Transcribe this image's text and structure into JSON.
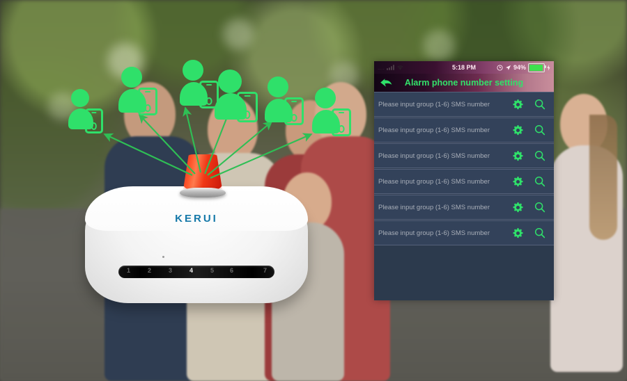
{
  "scene": {
    "device_brand": "KERUI",
    "device_strip_numbers": [
      "1",
      "2",
      "3",
      "4",
      "5",
      "6",
      "",
      "7"
    ],
    "device_strip_active": "4",
    "siren_name": "red-alarm-siren",
    "person_icon_count": 6,
    "arrow_count": 6,
    "accent_green": "#2fe06a",
    "brand_blue": "#1478a8",
    "siren_red": "#ef2d14"
  },
  "phone": {
    "status_bar": {
      "carrier": "....",
      "wifi_icon": "wifi-icon",
      "time": "5:18 PM",
      "alarm_icon": "alarm-clock-icon",
      "location_icon": "location-arrow-icon",
      "battery_percent": "94%",
      "battery_fill": 94,
      "charging_icon": "lightning-bolt-icon"
    },
    "titlebar": {
      "back_label": "back-arrow-icon",
      "title": "Alarm phone number setting"
    },
    "list": {
      "placeholder": "Please input group (1-6) SMS number",
      "gear_icon": "gear-icon",
      "search_icon": "search-icon",
      "rows": [
        {
          "value": "",
          "index": 1
        },
        {
          "value": "",
          "index": 2
        },
        {
          "value": "",
          "index": 3
        },
        {
          "value": "",
          "index": 4
        },
        {
          "value": "",
          "index": 5
        },
        {
          "value": "",
          "index": 6
        }
      ]
    }
  }
}
